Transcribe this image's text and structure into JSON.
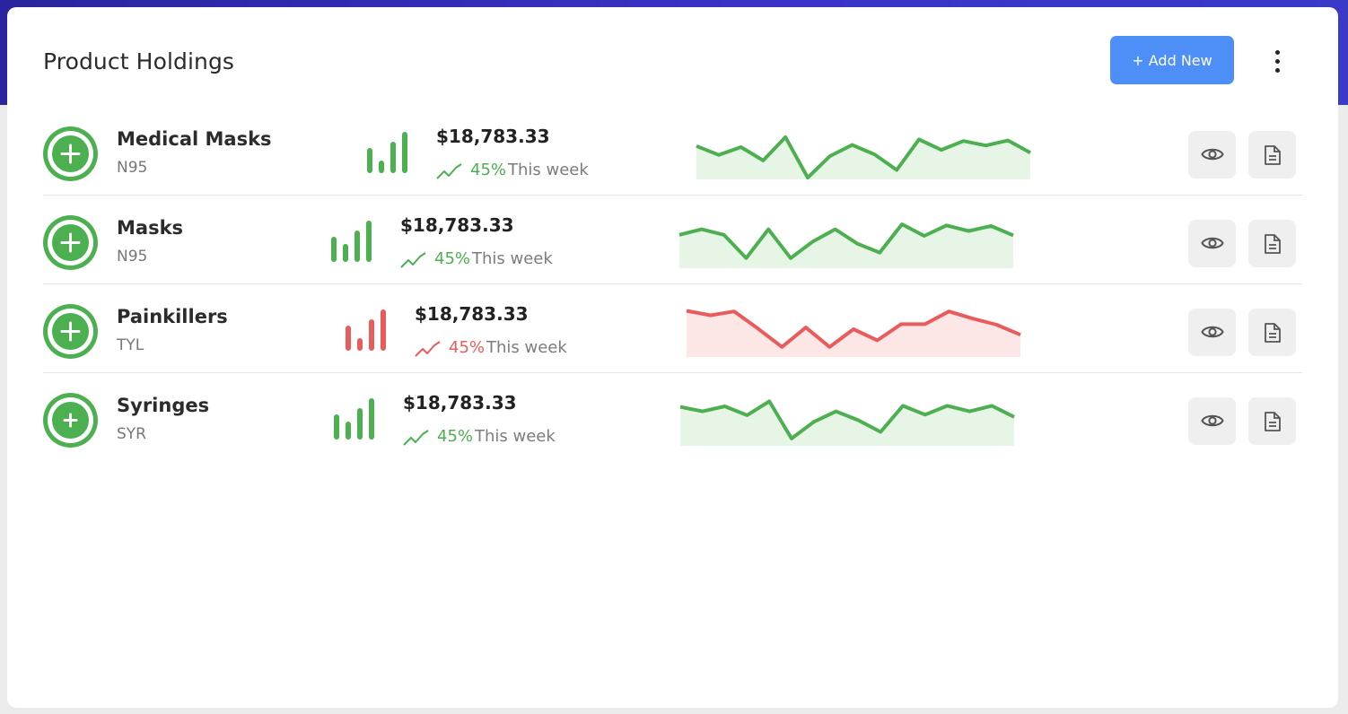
{
  "card": {
    "title": "Product Holdings",
    "add_button_label": "+ Add New",
    "accent": "#4d8ef7"
  },
  "colors": {
    "positive": "#4caf50",
    "negative": "#e85c5c"
  },
  "icons": {
    "product": "plus-circle-icon",
    "stats": "bar-chart-icon",
    "trend": "trend-up-icon",
    "view": "eye-icon",
    "report": "document-icon",
    "menu": "more-vertical-icon"
  },
  "products": [
    {
      "name": "Medical Masks",
      "code": "N95",
      "price": "$18,783.33",
      "change_pct": "45%",
      "change_label": "This week",
      "status": "positive",
      "sparkline": [
        60,
        44,
        58,
        34,
        76,
        3,
        42,
        62,
        45,
        17,
        72,
        53,
        69,
        61,
        70,
        48
      ]
    },
    {
      "name": "Masks",
      "code": "N95",
      "price": "$18,783.33",
      "change_pct": "45%",
      "change_label": "This week",
      "status": "positive",
      "sparkline": [
        60,
        70,
        60,
        18,
        70,
        18,
        48,
        70,
        44,
        28,
        79,
        58,
        77,
        67,
        76,
        59
      ]
    },
    {
      "name": "Painkillers",
      "code": "TYL",
      "price": "$18,783.33",
      "change_pct": "45%",
      "change_label": "This week",
      "status": "negative",
      "sparkline": [
        83,
        75,
        82,
        51,
        18,
        53,
        18,
        50,
        30,
        59,
        59,
        82,
        69,
        58,
        40
      ]
    },
    {
      "name": "Syringes",
      "code": "SYR",
      "price": "$18,783.33",
      "change_pct": "45%",
      "change_label": "This week",
      "status": "positive",
      "sparkline": [
        70,
        62,
        71,
        55,
        80,
        13,
        43,
        62,
        46,
        25,
        72,
        56,
        72,
        62,
        72,
        52
      ]
    }
  ]
}
